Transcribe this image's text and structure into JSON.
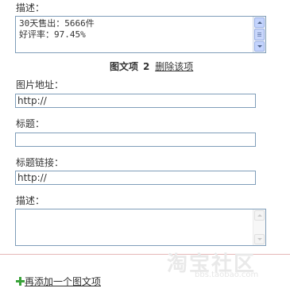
{
  "section1": {
    "desc_label": "描述：",
    "desc_line1": "30天售出：5666件",
    "desc_line2": "好评率：97.45%"
  },
  "section2": {
    "item_label": "图文项",
    "item_number": "2",
    "delete_link": "删除该项",
    "image_url_label": "图片地址：",
    "image_url_value": "http://",
    "title_label": "标题：",
    "title_value": "",
    "title_link_label": "标题链接：",
    "title_link_value": "http://",
    "desc_label": "描述：",
    "desc_value": ""
  },
  "footer": {
    "add_label": "再添加一个图文项"
  },
  "watermark": {
    "logo_text": "淘宝社区",
    "sub_text": "bbs.taobao.com"
  },
  "icons": {
    "add": "plus-icon",
    "scroll_up": "arrow-up-icon",
    "scroll_down": "arrow-down-icon"
  },
  "colors": {
    "input_border": "#7f9db9",
    "divider": "#e6b8b8",
    "add_icon": "#3aa33a"
  }
}
